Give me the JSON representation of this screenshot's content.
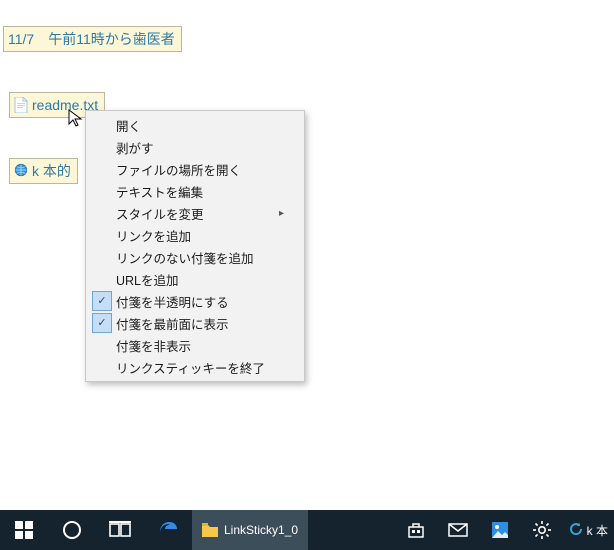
{
  "stickies": {
    "note1": {
      "text": "11/7　午前11時から歯医者"
    },
    "note2": {
      "text": "readme.txt"
    },
    "note3": {
      "text": "k 本的"
    }
  },
  "context_menu": {
    "open": "開く",
    "peel": "剥がす",
    "open_location": "ファイルの場所を開く",
    "edit_text": "テキストを編集",
    "change_style": "スタイルを変更",
    "add_link": "リンクを追加",
    "add_no_link": "リンクのない付箋を追加",
    "add_url": "URLを追加",
    "semi_transparent": "付箋を半透明にする",
    "always_on_top": "付箋を最前面に表示",
    "hide": "付箋を非表示",
    "exit": "リンクスティッキーを終了"
  },
  "taskbar": {
    "app_label": "LinkSticky1_0",
    "tray_app": "k 本"
  }
}
